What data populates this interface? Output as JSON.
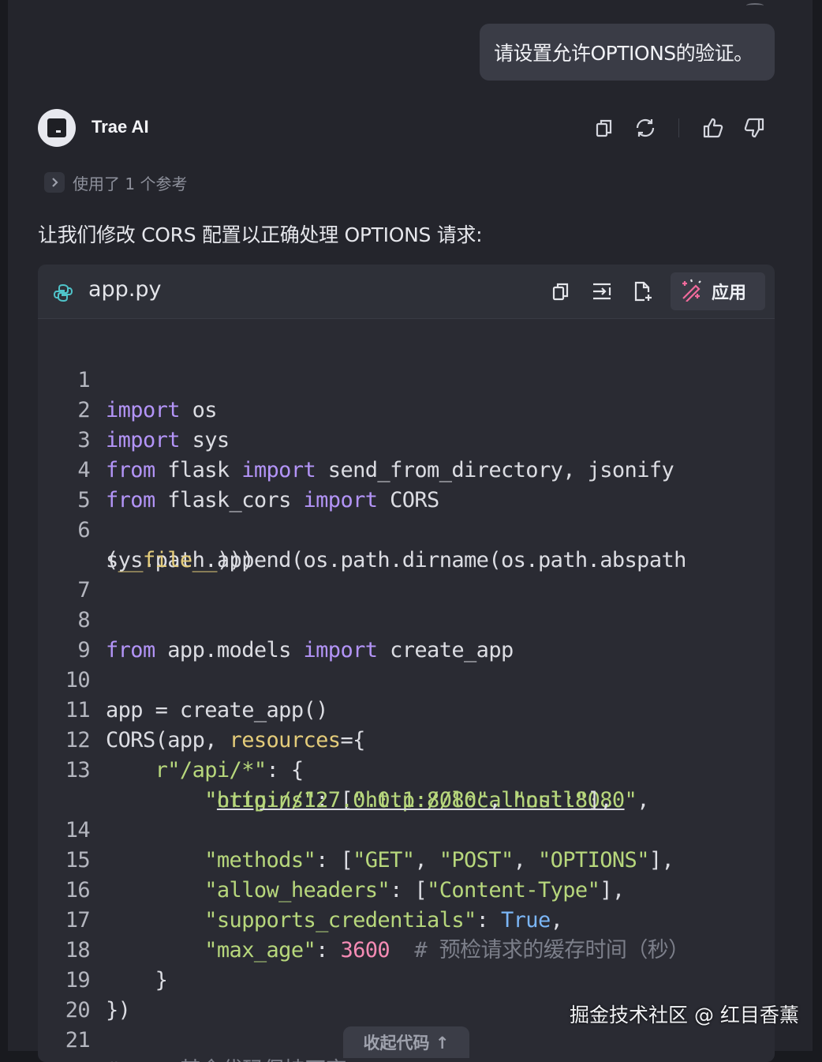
{
  "user_message": "请设置允许OPTIONS的验证。",
  "assistant": {
    "name": "Trae AI",
    "avatar_icon": "trae-logo-icon",
    "actions": [
      "copy-icon",
      "regenerate-icon",
      "thumbs-up-icon",
      "thumbs-down-icon"
    ],
    "references_label": "使用了 1 个参考",
    "intro": "让我们修改 CORS 配置以正确处理 OPTIONS 请求:"
  },
  "code_block": {
    "filename": "app.py",
    "file_icon": "python-icon",
    "tools": [
      "copy-icon",
      "insert-icon",
      "new-file-icon"
    ],
    "apply_label": "应用",
    "apply_icon": "magic-wand-icon",
    "collapse_label": "收起代码 ↑",
    "lines": [
      {
        "n": "1",
        "text": "import os"
      },
      {
        "n": "2",
        "text": "import sys"
      },
      {
        "n": "3",
        "text": "from flask import send_from_directory, jsonify"
      },
      {
        "n": "4",
        "text": "from flask_cors import CORS"
      },
      {
        "n": "5",
        "text": ""
      },
      {
        "n": "6",
        "text": "sys.path.append(os.path.dirname(os.path.abspath"
      },
      {
        "n": "",
        "text": "(__file__)))"
      },
      {
        "n": "7",
        "text": ""
      },
      {
        "n": "8",
        "text": "from app.models import create_app"
      },
      {
        "n": "9",
        "text": ""
      },
      {
        "n": "10",
        "text": "app = create_app()"
      },
      {
        "n": "11",
        "text": "CORS(app, resources={"
      },
      {
        "n": "12",
        "text": "    r\"/api/*\": {"
      },
      {
        "n": "13",
        "text": "        \"origins\": [\"http://localhost:8080\","
      },
      {
        "n": "",
        "text": "        \"http://127.0.0.1:8080\", \"null\"],"
      },
      {
        "n": "14",
        "text": "        \"methods\": [\"GET\", \"POST\", \"OPTIONS\"],"
      },
      {
        "n": "15",
        "text": "        \"allow_headers\": [\"Content-Type\"],"
      },
      {
        "n": "16",
        "text": "        \"supports_credentials\": True,"
      },
      {
        "n": "17",
        "text": "        \"max_age\": 3600  # 预检请求的缓存时间（秒）"
      },
      {
        "n": "18",
        "text": "    }"
      },
      {
        "n": "19",
        "text": "})"
      },
      {
        "n": "20",
        "text": ""
      },
      {
        "n": "21",
        "text": "# ... 其余代码保持不变 ..."
      }
    ]
  },
  "watermark": "掘金技术社区 @ 红目香薰",
  "colors": {
    "background": "#24252c",
    "keyword": "#b394f7",
    "string": "#b7d77c",
    "number": "#f58bb4",
    "boolean": "#7bb6f6",
    "parameter": "#e4cc7a",
    "comment": "#7c7f8a"
  }
}
